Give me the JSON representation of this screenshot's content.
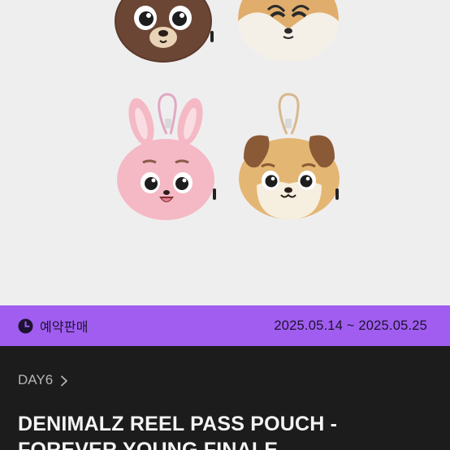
{
  "product": {
    "image_alt": "Denimalz plush pass pouches",
    "characters": [
      {
        "name": "brown-bear",
        "color": "#6b4634"
      },
      {
        "name": "fox",
        "color": "#e0ad6c"
      },
      {
        "name": "pink-rabbit",
        "color": "#f4b9c5"
      },
      {
        "name": "puppy",
        "color": "#e3b673"
      }
    ]
  },
  "preorder": {
    "icon": "clock-icon",
    "label": "예약판매",
    "dates": "2025.05.14 ~ 2025.05.25",
    "bar_color": "#a15df0"
  },
  "details": {
    "artist": "DAY6",
    "artist_icon": "chevron-right-icon",
    "title": "DENIMALZ REEL PASS POUCH - FOREVER YOUNG FINALE"
  }
}
